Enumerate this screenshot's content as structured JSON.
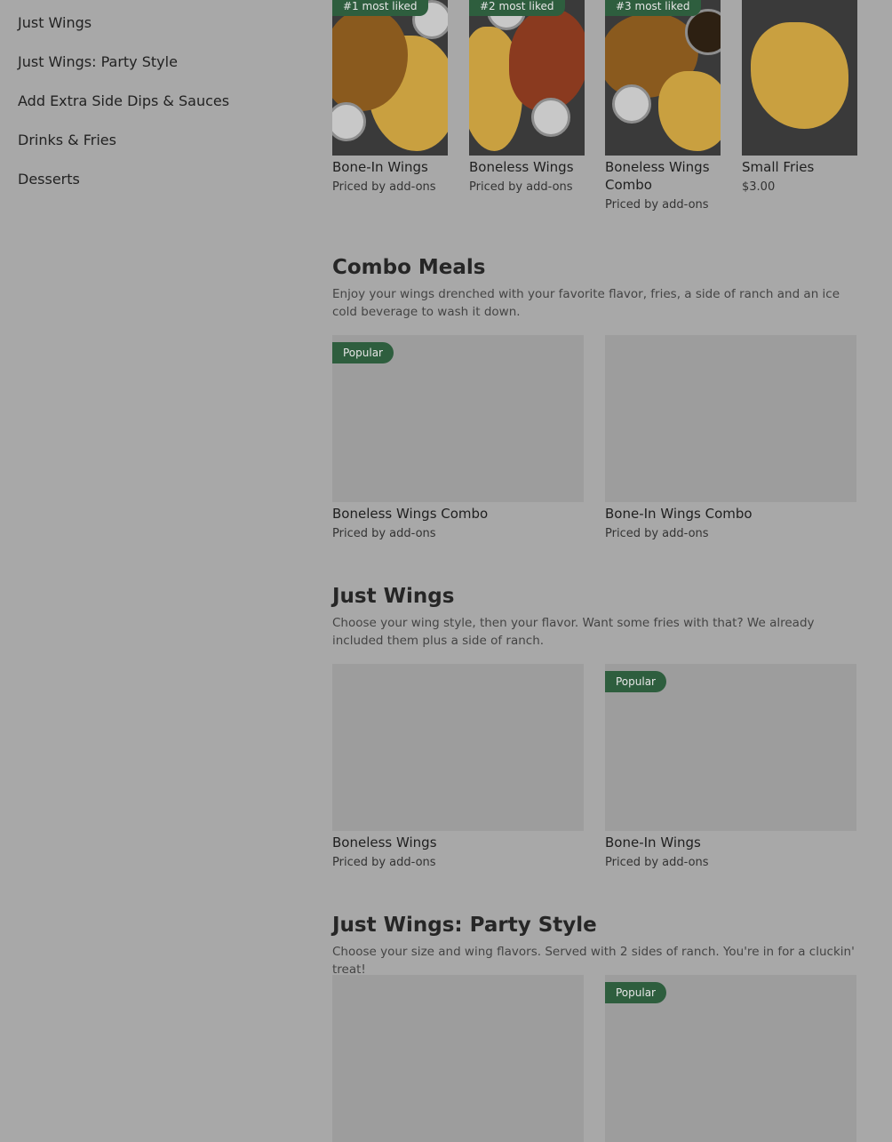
{
  "sidebar": {
    "items": [
      {
        "label": "Just Wings"
      },
      {
        "label": "Just Wings: Party Style"
      },
      {
        "label": "Add Extra Side Dips & Sauces"
      },
      {
        "label": "Drinks & Fries"
      },
      {
        "label": "Desserts"
      }
    ]
  },
  "top_items": [
    {
      "badge": "#1 most liked",
      "name": "Bone-In Wings",
      "price": "Priced by add-ons"
    },
    {
      "badge": "#2 most liked",
      "name": "Boneless Wings",
      "price": "Priced by add-ons"
    },
    {
      "badge": "#3 most liked",
      "name": "Boneless Wings Combo",
      "price": "Priced by add-ons"
    },
    {
      "badge": "",
      "name": "Small Fries",
      "price": "$3.00"
    }
  ],
  "sections": [
    {
      "title": "Combo Meals",
      "description": "Enjoy your wings drenched with your favorite flavor, fries, a side of ranch and an ice cold beverage to wash it down.",
      "items": [
        {
          "badge": "Popular",
          "name": "Boneless Wings Combo",
          "price": "Priced by add-ons"
        },
        {
          "badge": "",
          "name": "Bone-In Wings Combo",
          "price": "Priced by add-ons"
        }
      ]
    },
    {
      "title": "Just Wings",
      "description": "Choose your wing style, then your flavor. Want some fries with that? We already included them plus a side of ranch.",
      "items": [
        {
          "badge": "",
          "name": "Boneless Wings",
          "price": "Priced by add-ons"
        },
        {
          "badge": "Popular",
          "name": "Bone-In Wings",
          "price": "Priced by add-ons"
        }
      ]
    },
    {
      "title": "Just Wings: Party Style",
      "description": "Choose your size and wing flavors. Served with 2 sides of ranch. You're in for a cluckin' treat!",
      "items": [
        {
          "badge": "",
          "name": "",
          "price": ""
        },
        {
          "badge": "Popular",
          "name": "",
          "price": ""
        }
      ]
    }
  ],
  "colors": {
    "overlay_background": "#a8a8a8",
    "badge_green": "#2e5e3e"
  }
}
